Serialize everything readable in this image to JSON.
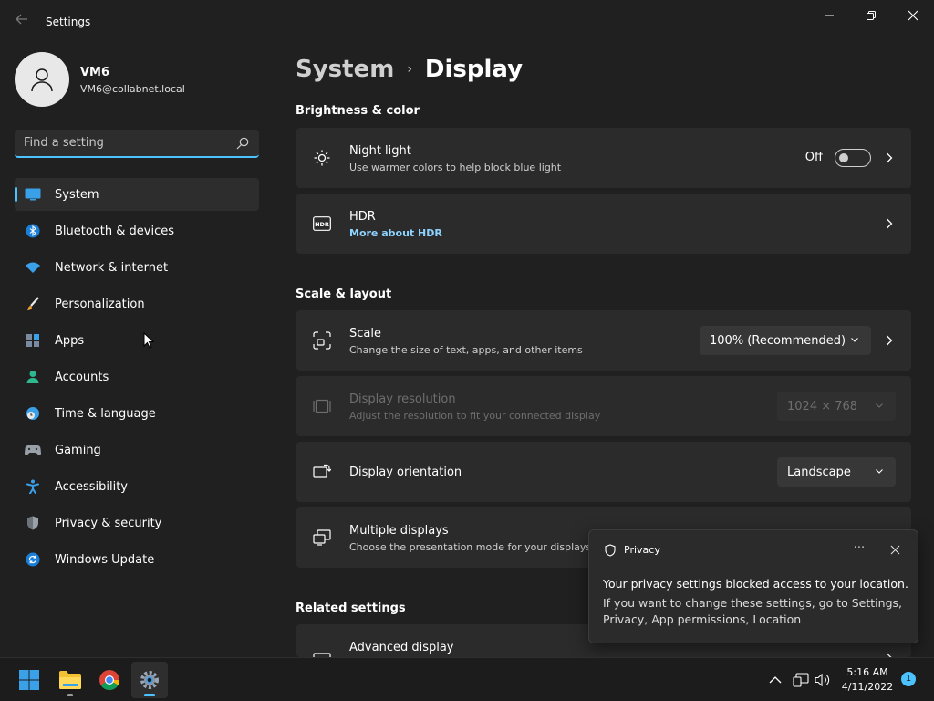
{
  "window": {
    "title": "Settings"
  },
  "user": {
    "name": "VM6",
    "email": "VM6@collabnet.local"
  },
  "search": {
    "placeholder": "Find a setting"
  },
  "nav": {
    "items": [
      {
        "label": "System",
        "icon": "monitor-icon",
        "active": true
      },
      {
        "label": "Bluetooth & devices",
        "icon": "bluetooth-icon"
      },
      {
        "label": "Network & internet",
        "icon": "wifi-icon"
      },
      {
        "label": "Personalization",
        "icon": "brush-icon"
      },
      {
        "label": "Apps",
        "icon": "apps-icon"
      },
      {
        "label": "Accounts",
        "icon": "person-icon"
      },
      {
        "label": "Time & language",
        "icon": "clock-globe-icon"
      },
      {
        "label": "Gaming",
        "icon": "gamepad-icon"
      },
      {
        "label": "Accessibility",
        "icon": "accessibility-icon"
      },
      {
        "label": "Privacy & security",
        "icon": "shield-icon"
      },
      {
        "label": "Windows Update",
        "icon": "update-icon"
      }
    ]
  },
  "breadcrumb": {
    "parent": "System",
    "separator": "›",
    "current": "Display"
  },
  "sections": {
    "brightness": "Brightness & color",
    "scale_layout": "Scale & layout",
    "related": "Related settings"
  },
  "cards": {
    "night_light": {
      "title": "Night light",
      "subtitle": "Use warmer colors to help block blue light",
      "state": "Off",
      "enabled": false
    },
    "hdr": {
      "title": "HDR",
      "link": "More about HDR"
    },
    "scale": {
      "title": "Scale",
      "subtitle": "Change the size of text, apps, and other items",
      "value": "100% (Recommended)"
    },
    "resolution": {
      "title": "Display resolution",
      "subtitle": "Adjust the resolution to fit your connected display",
      "value": "1024 × 768",
      "disabled": true
    },
    "orientation": {
      "title": "Display orientation",
      "value": "Landscape"
    },
    "multiple": {
      "title": "Multiple displays",
      "subtitle": "Choose the presentation mode for your displays"
    },
    "advanced": {
      "title": "Advanced display"
    }
  },
  "toast": {
    "app": "Privacy",
    "more": "···",
    "title": "Your privacy settings blocked access to your location.",
    "body": "If you want to change these settings, go to Settings, Privacy, App permissions, Location"
  },
  "taskbar": {
    "time": "5:16 AM",
    "date": "4/11/2022",
    "notifications": "1"
  },
  "colors": {
    "accent": "#4cc2ff",
    "background": "#202020",
    "card": "#2b2b2b"
  }
}
